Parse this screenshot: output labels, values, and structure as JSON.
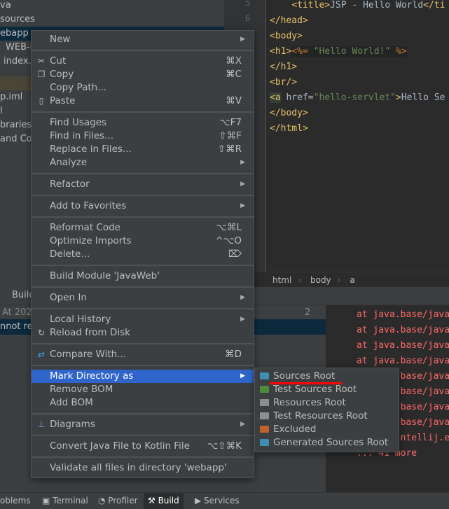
{
  "project_tree": [
    "va",
    "sources",
    "ebapp",
    "WEB-I",
    "index.j",
    "",
    "p.iml",
    "l",
    "braries",
    "and Cor"
  ],
  "editor": {
    "line_numbers": [
      "5",
      "6"
    ],
    "lines": [
      [
        {
          "t": "    "
        },
        {
          "c": "tag",
          "t": "<title>"
        },
        {
          "t": "JSP - Hello World"
        },
        {
          "c": "tag",
          "t": "</ti"
        }
      ],
      [
        {
          "c": "tag",
          "t": "</head>"
        }
      ],
      [
        {
          "c": "tag",
          "t": "<body>"
        }
      ],
      [
        {
          "c": "tag",
          "t": "<h1>"
        },
        {
          "c": "jsp",
          "t": "<%= "
        },
        {
          "c": "str",
          "t": "\"Hello World!\""
        },
        {
          "c": "jsp",
          "t": " %>"
        }
      ],
      [
        {
          "c": "tag",
          "t": "</h1>"
        }
      ],
      [
        {
          "c": "tag",
          "t": "<br/>"
        }
      ],
      [
        {
          "c": "tag",
          "t": "<a"
        },
        {
          "t": " href="
        },
        {
          "c": "str",
          "t": "\"hello-servlet\""
        },
        {
          "c": "tag",
          "t": ">"
        },
        {
          "t": "Hello Se"
        }
      ],
      [
        {
          "c": "tag",
          "t": "</body>"
        }
      ],
      [
        {
          "c": "tag",
          "t": "</html>"
        }
      ]
    ],
    "breadcrumbs": [
      "html",
      "body",
      "a"
    ]
  },
  "build_panel": {
    "tab": "Builc",
    "row1": "At 202",
    "row1_time": "2 ms",
    "row2": "nnot rec",
    "console": [
      "at java.base/java",
      "at java.base/java",
      "at java.base/java",
      "at java.base/java",
      "at java.base/java",
      "at java.base/java",
      "at java.base/java",
      "at java.base/java",
      "at com.intellij.e",
      "... 41 more"
    ]
  },
  "status_bar": [
    "oblems",
    "Terminal",
    "Profiler",
    "Build",
    "Services"
  ],
  "context_menu": [
    {
      "label": "New",
      "arrow": true
    },
    {
      "sep": true
    },
    {
      "label": "Cut",
      "shortcut": "⌘X",
      "icon": "scissors-icon",
      "glyph": "✂"
    },
    {
      "label": "Copy",
      "shortcut": "⌘C",
      "icon": "copy-icon",
      "glyph": "❐"
    },
    {
      "label": "Copy Path..."
    },
    {
      "label": "Paste",
      "shortcut": "⌘V",
      "icon": "clipboard-icon",
      "glyph": "▯"
    },
    {
      "sep": true
    },
    {
      "label": "Find Usages",
      "shortcut": "⌥F7"
    },
    {
      "label": "Find in Files...",
      "shortcut": "⇧⌘F"
    },
    {
      "label": "Replace in Files...",
      "shortcut": "⇧⌘R"
    },
    {
      "label": "Analyze",
      "arrow": true
    },
    {
      "sep": true
    },
    {
      "label": "Refactor",
      "arrow": true
    },
    {
      "sep": true
    },
    {
      "label": "Add to Favorites",
      "arrow": true
    },
    {
      "sep": true
    },
    {
      "label": "Reformat Code",
      "shortcut": "⌥⌘L"
    },
    {
      "label": "Optimize Imports",
      "shortcut": "^⌥O"
    },
    {
      "label": "Delete...",
      "shortcut": "⌦"
    },
    {
      "sep": true
    },
    {
      "label": "Build Module 'JavaWeb'"
    },
    {
      "sep": true
    },
    {
      "label": "Open In",
      "arrow": true
    },
    {
      "sep": true
    },
    {
      "label": "Local History",
      "arrow": true
    },
    {
      "label": "Reload from Disk",
      "icon": "reload-icon",
      "glyph": "↻"
    },
    {
      "sep": true
    },
    {
      "label": "Compare With...",
      "shortcut": "⌘D",
      "icon": "compare-icon",
      "glyph": "⇄"
    },
    {
      "sep": true
    },
    {
      "label": "Mark Directory as",
      "arrow": true,
      "selected": true
    },
    {
      "label": "Remove BOM"
    },
    {
      "label": "Add BOM"
    },
    {
      "sep": true
    },
    {
      "label": "Diagrams",
      "arrow": true,
      "icon": "diagram-icon",
      "glyph": "⊥"
    },
    {
      "sep": true
    },
    {
      "label": "Convert Java File to Kotlin File",
      "shortcut": "⌥⇧⌘K"
    },
    {
      "sep": true
    },
    {
      "label": "Validate all files in directory 'webapp'"
    }
  ],
  "submenu": [
    {
      "label": "Sources Root",
      "icon": "sources-root-folder-icon",
      "color": "#3d8eb0"
    },
    {
      "label": "Test Sources Root",
      "icon": "test-sources-folder-icon",
      "color": "#4f8a3b"
    },
    {
      "label": "Resources Root",
      "icon": "resources-folder-icon",
      "color": "#8a8f94"
    },
    {
      "label": "Test Resources Root",
      "icon": "test-resources-folder-icon",
      "color": "#8a8f94"
    },
    {
      "label": "Excluded",
      "icon": "excluded-folder-icon",
      "color": "#c0622b"
    },
    {
      "label": "Generated Sources Root",
      "icon": "generated-sources-folder-icon",
      "color": "#3d8eb0"
    }
  ],
  "colors": {
    "selection": "#2f65ca",
    "annotation": "#ff0000"
  }
}
